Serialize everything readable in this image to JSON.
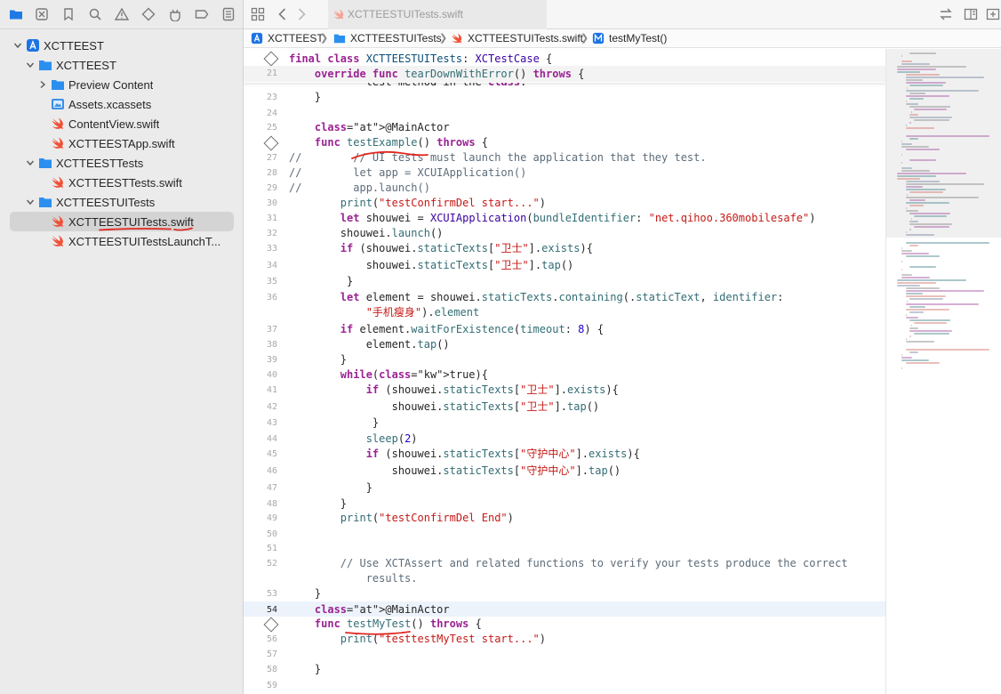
{
  "sidebar": {
    "nav_icons": [
      "folder-icon",
      "source-control-icon",
      "bookmark-icon",
      "find-icon",
      "issue-icon",
      "test-icon",
      "debug-icon",
      "breakpoint-icon",
      "report-icon"
    ],
    "tree": [
      {
        "label": "XCTTEEST",
        "kind": "project",
        "expanded": true,
        "depth": 0
      },
      {
        "label": "XCTTEEST",
        "kind": "folder",
        "expanded": true,
        "depth": 1
      },
      {
        "label": "Preview Content",
        "kind": "folder",
        "expanded": false,
        "depth": 2
      },
      {
        "label": "Assets.xcassets",
        "kind": "assets",
        "depth": 2
      },
      {
        "label": "ContentView.swift",
        "kind": "swift",
        "depth": 2
      },
      {
        "label": "XCTTEESTApp.swift",
        "kind": "swift",
        "depth": 2
      },
      {
        "label": "XCTTEESTTests",
        "kind": "folder",
        "expanded": true,
        "depth": 1
      },
      {
        "label": "XCTTEESTTests.swift",
        "kind": "swift",
        "depth": 2
      },
      {
        "label": "XCTTEESTUITests",
        "kind": "folder",
        "expanded": true,
        "depth": 1
      },
      {
        "label": "XCTTEESTUITests.swift",
        "kind": "swift",
        "depth": 2,
        "selected": true
      },
      {
        "label": "XCTTEESTUITestsLaunchT...",
        "kind": "swift",
        "depth": 2
      }
    ]
  },
  "toolbar": {
    "tab_title": "XCTTEESTUITests.swift"
  },
  "breadcrumb": {
    "items": [
      "XCTTEEST",
      "XCTTEESTUITests",
      "XCTTEESTUITests.swift",
      "testMyTest()"
    ],
    "separator": "❯"
  },
  "editor": {
    "current_line": "54",
    "sticky": {
      "line1": "final class XCTTEESTUITests: XCTestCase {",
      "line2_num": "21",
      "line2": "    override func tearDownWithError() throws {"
    },
    "lines": [
      {
        "n": "",
        "t": "            test method in the class."
      },
      {
        "n": "23",
        "t": "    }"
      },
      {
        "n": "24",
        "t": ""
      },
      {
        "n": "25",
        "t": "    @MainActor"
      },
      {
        "n": "",
        "t": "    func testExample() throws {",
        "diamond": true
      },
      {
        "n": "27",
        "t": "//        // UI tests must launch the application that they test."
      },
      {
        "n": "28",
        "t": "//        let app = XCUIApplication()"
      },
      {
        "n": "29",
        "t": "//        app.launch()"
      },
      {
        "n": "30",
        "t": "        print(\"testConfirmDel start...\")"
      },
      {
        "n": "31",
        "t": "        let shouwei = XCUIApplication(bundleIdentifier: \"net.qihoo.360mobilesafe\")"
      },
      {
        "n": "32",
        "t": "        shouwei.launch()"
      },
      {
        "n": "33",
        "t": "        if (shouwei.staticTexts[\"卫士\"].exists){"
      },
      {
        "n": "34",
        "t": "            shouwei.staticTexts[\"卫士\"].tap()"
      },
      {
        "n": "35",
        "t": "         }"
      },
      {
        "n": "36",
        "t": "        let element = shouwei.staticTexts.containing(.staticText, identifier:"
      },
      {
        "n": "",
        "t": "            \"手机瘦身\").element"
      },
      {
        "n": "37",
        "t": "        if element.waitForExistence(timeout: 8) {"
      },
      {
        "n": "38",
        "t": "            element.tap()"
      },
      {
        "n": "39",
        "t": "        }"
      },
      {
        "n": "40",
        "t": "        while(true){"
      },
      {
        "n": "41",
        "t": "            if (shouwei.staticTexts[\"卫士\"].exists){"
      },
      {
        "n": "42",
        "t": "                shouwei.staticTexts[\"卫士\"].tap()"
      },
      {
        "n": "43",
        "t": "             }"
      },
      {
        "n": "44",
        "t": "            sleep(2)"
      },
      {
        "n": "45",
        "t": "            if (shouwei.staticTexts[\"守护中心\"].exists){"
      },
      {
        "n": "46",
        "t": "                shouwei.staticTexts[\"守护中心\"].tap()"
      },
      {
        "n": "47",
        "t": "            }"
      },
      {
        "n": "48",
        "t": "        }"
      },
      {
        "n": "49",
        "t": "        print(\"testConfirmDel End\")"
      },
      {
        "n": "50",
        "t": ""
      },
      {
        "n": "51",
        "t": ""
      },
      {
        "n": "52",
        "t": "        // Use XCTAssert and related functions to verify your tests produce the correct"
      },
      {
        "n": "",
        "t": "            results."
      },
      {
        "n": "53",
        "t": "    }"
      },
      {
        "n": "54",
        "t": "    @MainActor"
      },
      {
        "n": "",
        "t": "    func testMyTest() throws {",
        "diamond": true
      },
      {
        "n": "56",
        "t": "        print(\"testtestMyTest start...\")"
      },
      {
        "n": "57",
        "t": ""
      },
      {
        "n": "58",
        "t": "    }"
      },
      {
        "n": "59",
        "t": ""
      }
    ]
  },
  "colors": {
    "accent": "#1f7ae6",
    "keyword": "#9b2393",
    "string": "#c41a16",
    "comment": "#5d6c79",
    "annotation_ink": "#e0271f"
  }
}
